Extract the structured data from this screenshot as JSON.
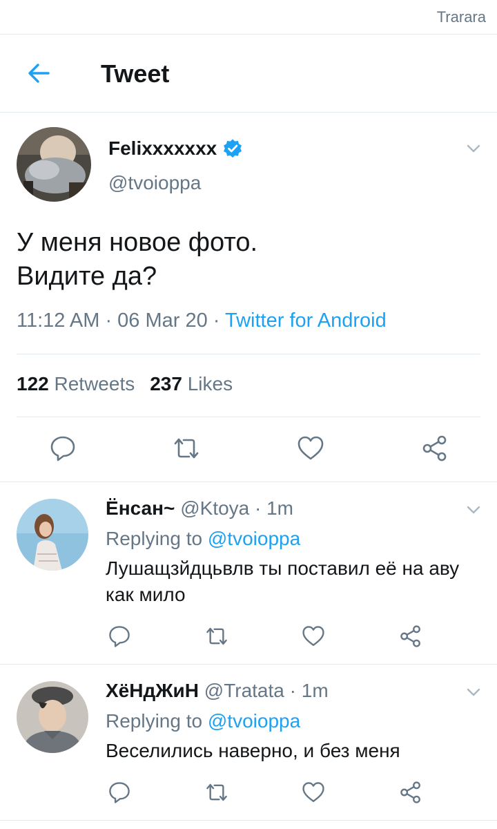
{
  "status_bar": {
    "text": "Trarara"
  },
  "header": {
    "title": "Tweet"
  },
  "tweet": {
    "author_name": "Felixxxxxxx",
    "handle": "@tvoioppa",
    "text_line1": "У меня новое фото.",
    "text_line2": "Видите да?",
    "time": "11:12 AM",
    "date": "06 Mar 20",
    "source": "Twitter for Android",
    "retweets_count": "122",
    "retweets_label": "Retweets",
    "likes_count": "237",
    "likes_label": "Likes"
  },
  "replies": [
    {
      "name": "Ёнсан~",
      "handle": "@Ktoya",
      "time": "1m",
      "replying_prefix": "Replying to",
      "replying_to": "@tvoioppa",
      "text": "Лушащзйдцьвлв ты поставил её на аву как мило"
    },
    {
      "name": "ХёНдЖиН",
      "handle": "@Tratata",
      "time": "1m",
      "replying_prefix": "Replying to",
      "replying_to": "@tvoioppa",
      "text": "Веселились наверно, и без меня"
    }
  ],
  "colors": {
    "accent": "#1da1f2",
    "secondary_text": "#657786",
    "divider": "#e1e8ed",
    "text": "#14171a"
  },
  "icons": [
    "back-arrow-icon",
    "verified-badge-icon",
    "chevron-down-icon",
    "reply-icon",
    "retweet-icon",
    "like-icon",
    "share-icon"
  ]
}
